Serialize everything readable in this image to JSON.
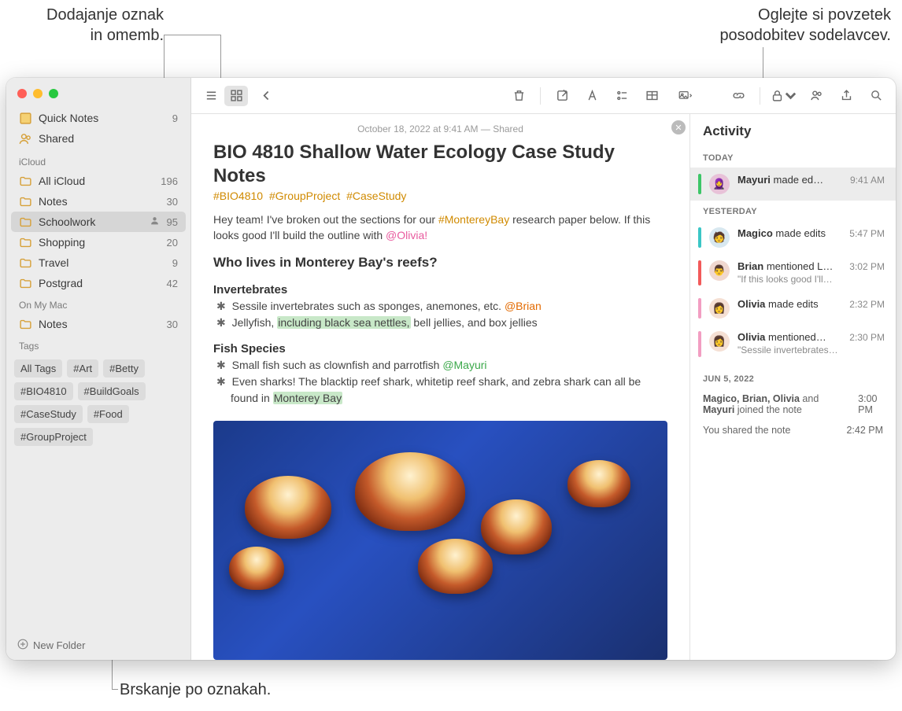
{
  "callouts": {
    "left_top": "Dodajanje oznak\nin omemb.",
    "right_top": "Oglejte si povzetek\nposodobitev sodelavcev.",
    "bottom": "Brskanje po oznakah."
  },
  "sidebar": {
    "quick_notes": {
      "label": "Quick Notes",
      "count": "9"
    },
    "shared": {
      "label": "Shared"
    },
    "icloud_header": "iCloud",
    "icloud": [
      {
        "label": "All iCloud",
        "count": "196"
      },
      {
        "label": "Notes",
        "count": "30"
      },
      {
        "label": "Schoolwork",
        "count": "95",
        "shared": true,
        "selected": true
      },
      {
        "label": "Shopping",
        "count": "20"
      },
      {
        "label": "Travel",
        "count": "9"
      },
      {
        "label": "Postgrad",
        "count": "42"
      }
    ],
    "onmymac_header": "On My Mac",
    "onmymac": [
      {
        "label": "Notes",
        "count": "30"
      }
    ],
    "tags_header": "Tags",
    "tags": [
      "All Tags",
      "#Art",
      "#Betty",
      "#BIO4810",
      "#BuildGoals",
      "#CaseStudy",
      "#Food",
      "#GroupProject"
    ],
    "new_folder": "New Folder"
  },
  "note": {
    "date": "October 18, 2022 at 9:41 AM — Shared",
    "title": "BIO 4810 Shallow Water Ecology Case Study Notes",
    "tags": [
      "#BIO4810",
      "#GroupProject",
      "#CaseStudy"
    ],
    "intro_a": "Hey team! I've broken out the sections for our ",
    "intro_hashtag": "#MontereyBay",
    "intro_b": " research paper below. If this looks good I'll build the outline with ",
    "intro_mention": "@Olivia!",
    "h2": "Who lives in Monterey Bay's reefs?",
    "section1": {
      "heading": "Invertebrates",
      "b1a": "Sessile invertebrates such as sponges, anemones, etc. ",
      "b1_mention": "@Brian",
      "b2a": "Jellyfish, ",
      "b2_hl": "including black sea nettles,",
      "b2b": " bell jellies, and box jellies"
    },
    "section2": {
      "heading": "Fish Species",
      "b1a": "Small fish such as clownfish and parrotfish ",
      "b1_mention": "@Mayuri",
      "b2a": "Even sharks! The blacktip reef shark, whitetip reef shark, and zebra shark can all be found in ",
      "b2_hl": "Monterey Bay"
    }
  },
  "activity": {
    "title": "Activity",
    "today": "TODAY",
    "yesterday": "YESTERDAY",
    "jun5": "JUN 5, 2022",
    "rows": {
      "r1_who": "Mayuri",
      "r1_action": " made ed…",
      "r1_time": "9:41 AM",
      "r2_who": "Magico",
      "r2_action": " made edits",
      "r2_time": "5:47 PM",
      "r3_who": "Brian",
      "r3_action": " mentioned L…",
      "r3_sub": "\"If this looks good I'll…",
      "r3_time": "3:02 PM",
      "r4_who": "Olivia",
      "r4_action": " made edits",
      "r4_time": "2:32 PM",
      "r5_who": "Olivia",
      "r5_action": " mentioned…",
      "r5_sub": "\"Sessile invertebrates…",
      "r5_time": "2:30 PM"
    },
    "jun": {
      "line1a": "Magico, Brian, Olivia",
      "line1b": " and ",
      "line1c": "Mayuri",
      "line1d": " joined the note",
      "t1": "3:00 PM",
      "line2": "You shared the note",
      "t2": "2:42 PM"
    }
  }
}
